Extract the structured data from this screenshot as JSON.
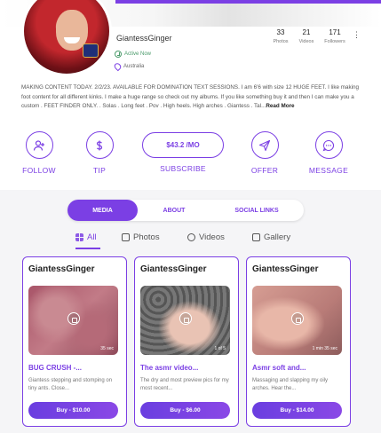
{
  "colors": {
    "accent": "#7b3fe4",
    "active_status": "#4a9a6a"
  },
  "profile": {
    "username": "GiantessGinger",
    "status": "Active Now",
    "location": "Australia",
    "stats": [
      {
        "num": "33",
        "label": "Photos"
      },
      {
        "num": "21",
        "label": "Videos"
      },
      {
        "num": "171",
        "label": "Followers"
      }
    ],
    "more_icon": "⋮",
    "bio": "MAKING CONTENT TODAY. 2/2/23. AVAILABLE FOR DOMINATION TEXT SESSIONS. I am 6'6 with size 12 HUGE FEET. I like making foot content for all different kinks. I make a huge range so check out my albums. If you like something buy it and then I can make you a custom . FEET FINDER ONLY. . Solas . Long feet . Pov . High heels. High arches . Giantess . Tal...",
    "read_more": "Read More"
  },
  "actions": {
    "follow": {
      "label": "FOLLOW",
      "icon": "follow-icon"
    },
    "tip": {
      "label": "TIP",
      "icon": "dollar-icon"
    },
    "subscribe": {
      "price": "$43.2 /MO",
      "label": "SUBSCRIBE"
    },
    "offer": {
      "label": "OFFER",
      "icon": "send-icon"
    },
    "message": {
      "label": "MESSAGE",
      "icon": "chat-icon"
    }
  },
  "tabs": [
    "MEDIA",
    "ABOUT",
    "SOCIAL LINKS"
  ],
  "active_tab": "MEDIA",
  "filters": [
    {
      "label": "All",
      "icon": "grid-icon"
    },
    {
      "label": "Photos",
      "icon": "image-icon"
    },
    {
      "label": "Videos",
      "icon": "video-icon"
    },
    {
      "label": "Gallery",
      "icon": "gallery-icon"
    }
  ],
  "active_filter": "All",
  "cards": [
    {
      "name": "GiantessGinger",
      "duration": "35 sec",
      "title": "BUG CRUSH -...",
      "desc": "Giantess stepping and stomping on tiny ants. Close...",
      "buy": "Buy - $10.00"
    },
    {
      "name": "GiantessGinger",
      "duration": "1 of 5",
      "title": "The asmr video...",
      "desc": "The dry and most preview pics for my most recent...",
      "buy": "Buy - $6.00"
    },
    {
      "name": "GiantessGinger",
      "duration": "1 min 35 sec",
      "title": "Asmr soft and...",
      "desc": "Massaging and slapping my oily arches. Hear the...",
      "buy": "Buy - $14.00"
    }
  ]
}
